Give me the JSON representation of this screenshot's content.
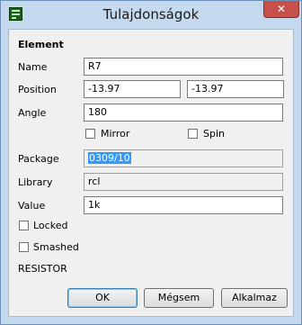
{
  "window": {
    "title": "Tulajdonságok",
    "close_glyph": "✕",
    "icon": "eagle-app-icon"
  },
  "element": {
    "heading": "Element",
    "name_label": "Name",
    "name_value": "R7",
    "position_label": "Position",
    "position_x": "-13.97",
    "position_y": "-13.97",
    "angle_label": "Angle",
    "angle_value": "180",
    "mirror_label": "Mirror",
    "mirror_checked": false,
    "spin_label": "Spin",
    "spin_checked": false,
    "package_label": "Package",
    "package_value": "0309/10",
    "library_label": "Library",
    "library_value": "rcl",
    "value_label": "Value",
    "value_value": "1k",
    "locked_label": "Locked",
    "locked_checked": false,
    "smashed_label": "Smashed",
    "smashed_checked": false,
    "technology_text": "RESISTOR"
  },
  "buttons": {
    "ok": "OK",
    "cancel": "Mégsem",
    "apply": "Alkalmaz"
  },
  "colors": {
    "frame": "#c4d9ee",
    "close_button": "#c7504a",
    "selection": "#3399ff"
  }
}
